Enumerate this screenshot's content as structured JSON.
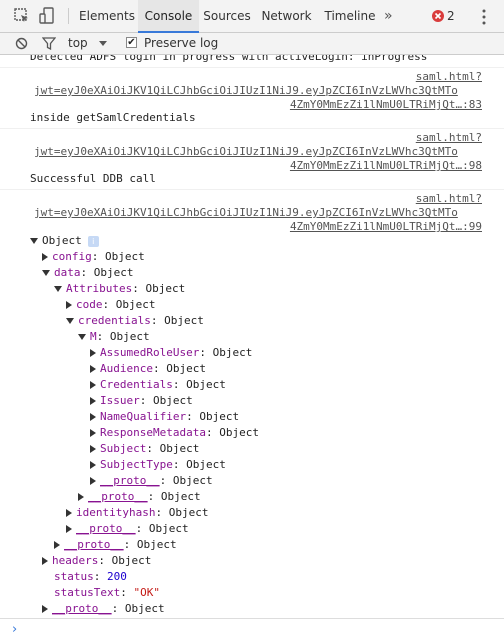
{
  "toolbar": {
    "tabs": [
      "Elements",
      "Console",
      "Sources",
      "Network",
      "Timeline"
    ],
    "active_tab": "Console",
    "more_label": "»",
    "error_count": "2"
  },
  "filterbar": {
    "context": "top",
    "preserve_log_label": "Preserve log",
    "preserve_log_checked": true
  },
  "console": {
    "cut_line": "Detected ADFS login in progress with activeLogin: inProgress",
    "entries": [
      {
        "source": "saml.html?",
        "jwt": "jwt=eyJ0eXAiOiJKV1QiLCJhbGciOiJIUzI1NiJ9.eyJpZCI6InVzLWVhc3QtMTo",
        "jwt2": "4ZmY0MmEzZi1lNmU0LTRiMjQt…:83",
        "message": "inside getSamlCredentials"
      },
      {
        "source": "saml.html?",
        "jwt": "jwt=eyJ0eXAiOiJKV1QiLCJhbGciOiJIUzI1NiJ9.eyJpZCI6InVzLWVhc3QtMTo",
        "jwt2": "4ZmY0MmEzZi1lNmU0LTRiMjQt…:98",
        "message": "Successful DDB call"
      },
      {
        "source": "saml.html?",
        "jwt": "jwt=eyJ0eXAiOiJKV1QiLCJhbGciOiJIUzI1NiJ9.eyJpZCI6InVzLWVhc3QtMTo",
        "jwt2": "4ZmY0MmEzZi1lNmU0LTRiMjQt…:99"
      }
    ],
    "tree": {
      "root": "Object",
      "info_icon": "i",
      "config": [
        "config",
        "Object"
      ],
      "data": [
        "data",
        "Object"
      ],
      "attributes": [
        "Attributes",
        "Object"
      ],
      "code": [
        "code",
        "Object"
      ],
      "credentials": [
        "credentials",
        "Object"
      ],
      "m": [
        "M",
        "Object"
      ],
      "m_children": [
        [
          "AssumedRoleUser",
          "Object"
        ],
        [
          "Audience",
          "Object"
        ],
        [
          "Credentials",
          "Object"
        ],
        [
          "Issuer",
          "Object"
        ],
        [
          "NameQualifier",
          "Object"
        ],
        [
          "ResponseMetadata",
          "Object"
        ],
        [
          "Subject",
          "Object"
        ],
        [
          "SubjectType",
          "Object"
        ],
        [
          "__proto__",
          "Object"
        ]
      ],
      "cred_proto": [
        "__proto__",
        "Object"
      ],
      "identityhash": [
        "identityhash",
        "Object"
      ],
      "attr_proto": [
        "__proto__",
        "Object"
      ],
      "data_proto": [
        "__proto__",
        "Object"
      ],
      "headers": [
        "headers",
        "Object"
      ],
      "status": [
        "status",
        "200"
      ],
      "statusText": [
        "statusText",
        "\"OK\""
      ],
      "root_proto": [
        "__proto__",
        "Object"
      ]
    }
  },
  "prompt_symbol": "›"
}
